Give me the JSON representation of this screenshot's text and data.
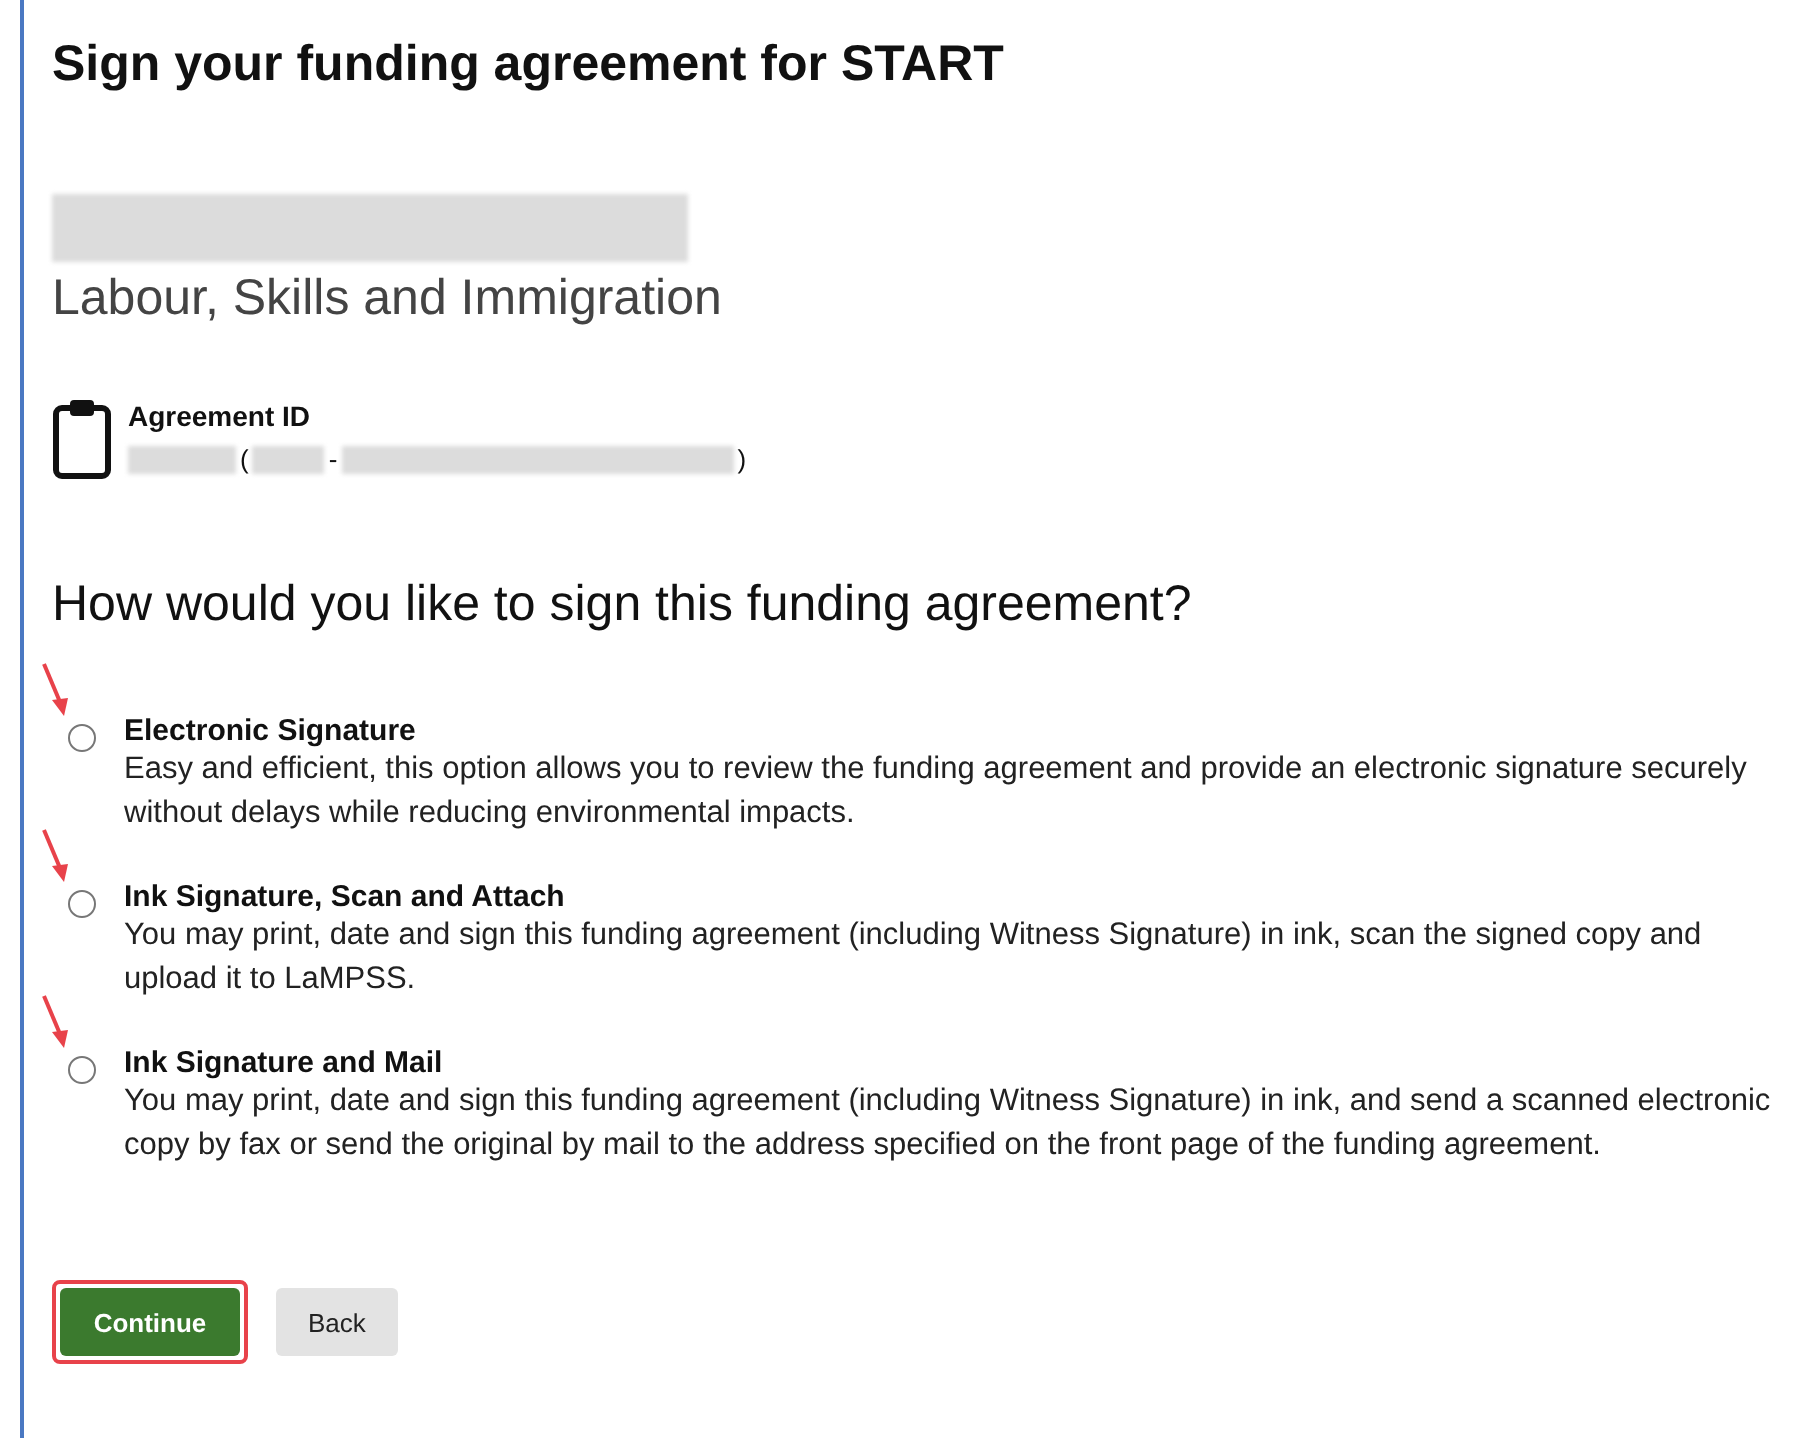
{
  "title": "Sign your funding agreement for START",
  "organization": "Labour, Skills and Immigration",
  "agreement": {
    "label": "Agreement ID",
    "value_parts": [
      "(",
      "-",
      ")"
    ]
  },
  "question": "How would you like to sign this funding agreement?",
  "options": [
    {
      "title": "Electronic Signature",
      "description": "Easy and efficient, this option allows you to review the funding agreement and provide an electronic signature securely without delays while reducing environmental impacts.",
      "selected": false,
      "annotated": true
    },
    {
      "title": "Ink Signature, Scan and Attach",
      "description": "You may print, date and sign this funding agreement (including Witness Signature) in ink, scan the signed copy and upload it to LaMPSS.",
      "selected": false,
      "annotated": true
    },
    {
      "title": "Ink Signature and Mail",
      "description": "You may print, date and sign this funding agreement (including Witness Signature) in ink, and send a scanned electronic copy by fax or send the original by mail to the address specified on the front page of the funding agreement.",
      "selected": false,
      "annotated": true
    }
  ],
  "buttons": [
    {
      "label": "Continue",
      "kind": "primary",
      "highlighted": true
    },
    {
      "label": "Back",
      "kind": "secondary",
      "highlighted": false
    }
  ]
}
